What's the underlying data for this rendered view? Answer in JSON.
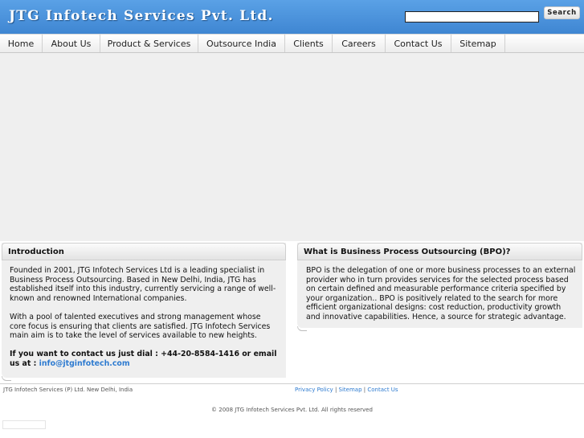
{
  "header": {
    "logo_text": "JTG Infotech Services Pvt. Ltd.",
    "search_placeholder": "",
    "search_button_label": "Search"
  },
  "nav": {
    "items": [
      {
        "label": "Home"
      },
      {
        "label": "About Us"
      },
      {
        "label": "Product & Services"
      },
      {
        "label": "Outsource India"
      },
      {
        "label": "Clients"
      },
      {
        "label": "Careers"
      },
      {
        "label": "Contact Us"
      },
      {
        "label": "Sitemap"
      }
    ]
  },
  "intro": {
    "heading": "Introduction",
    "paragraph1": "Founded in 2001, JTG Infotech Services Ltd is a leading specialist in Business Process Outsourcing. Based in New Delhi, India, JTG has established itself into this industry, currently servicing a range of well-known and renowned International companies.",
    "paragraph2": "With a pool of talented executives and strong management whose core focus is ensuring that clients are satisfied. JTG Infotech Services main aim is to take the level of services available to new heights.",
    "contact_text": "If you want to contact us just dial : +44-20-8584-1416 or email us at : ",
    "contact_email": "info@jtginfotech.com"
  },
  "bpo": {
    "heading": "What is Business Process Outsourcing (BPO)?",
    "paragraph": "BPO is the delegation of one or more business processes to an external provider who in turn provides services for the selected process based on certain defined and measurable performance criteria specified by your organization.. BPO is positively related to the search for more efficient organizational designs: cost reduction, productivity growth and innovative capabilities. Hence, a source for strategic advantage."
  },
  "footer": {
    "address": "JTG Infotech Services (P) Ltd. New Delhi, India",
    "links": [
      {
        "label": "Privacy Policy"
      },
      {
        "label": "Sitemap"
      },
      {
        "label": "Contact Us"
      }
    ],
    "separator": " | ",
    "copyright": "© 2008 JTG Infotech Services Pvt. Ltd. All rights reserved"
  },
  "colors": {
    "header_blue": "#4a93dc",
    "link_blue": "#2e7bd0",
    "panel_gray": "#efefef"
  }
}
